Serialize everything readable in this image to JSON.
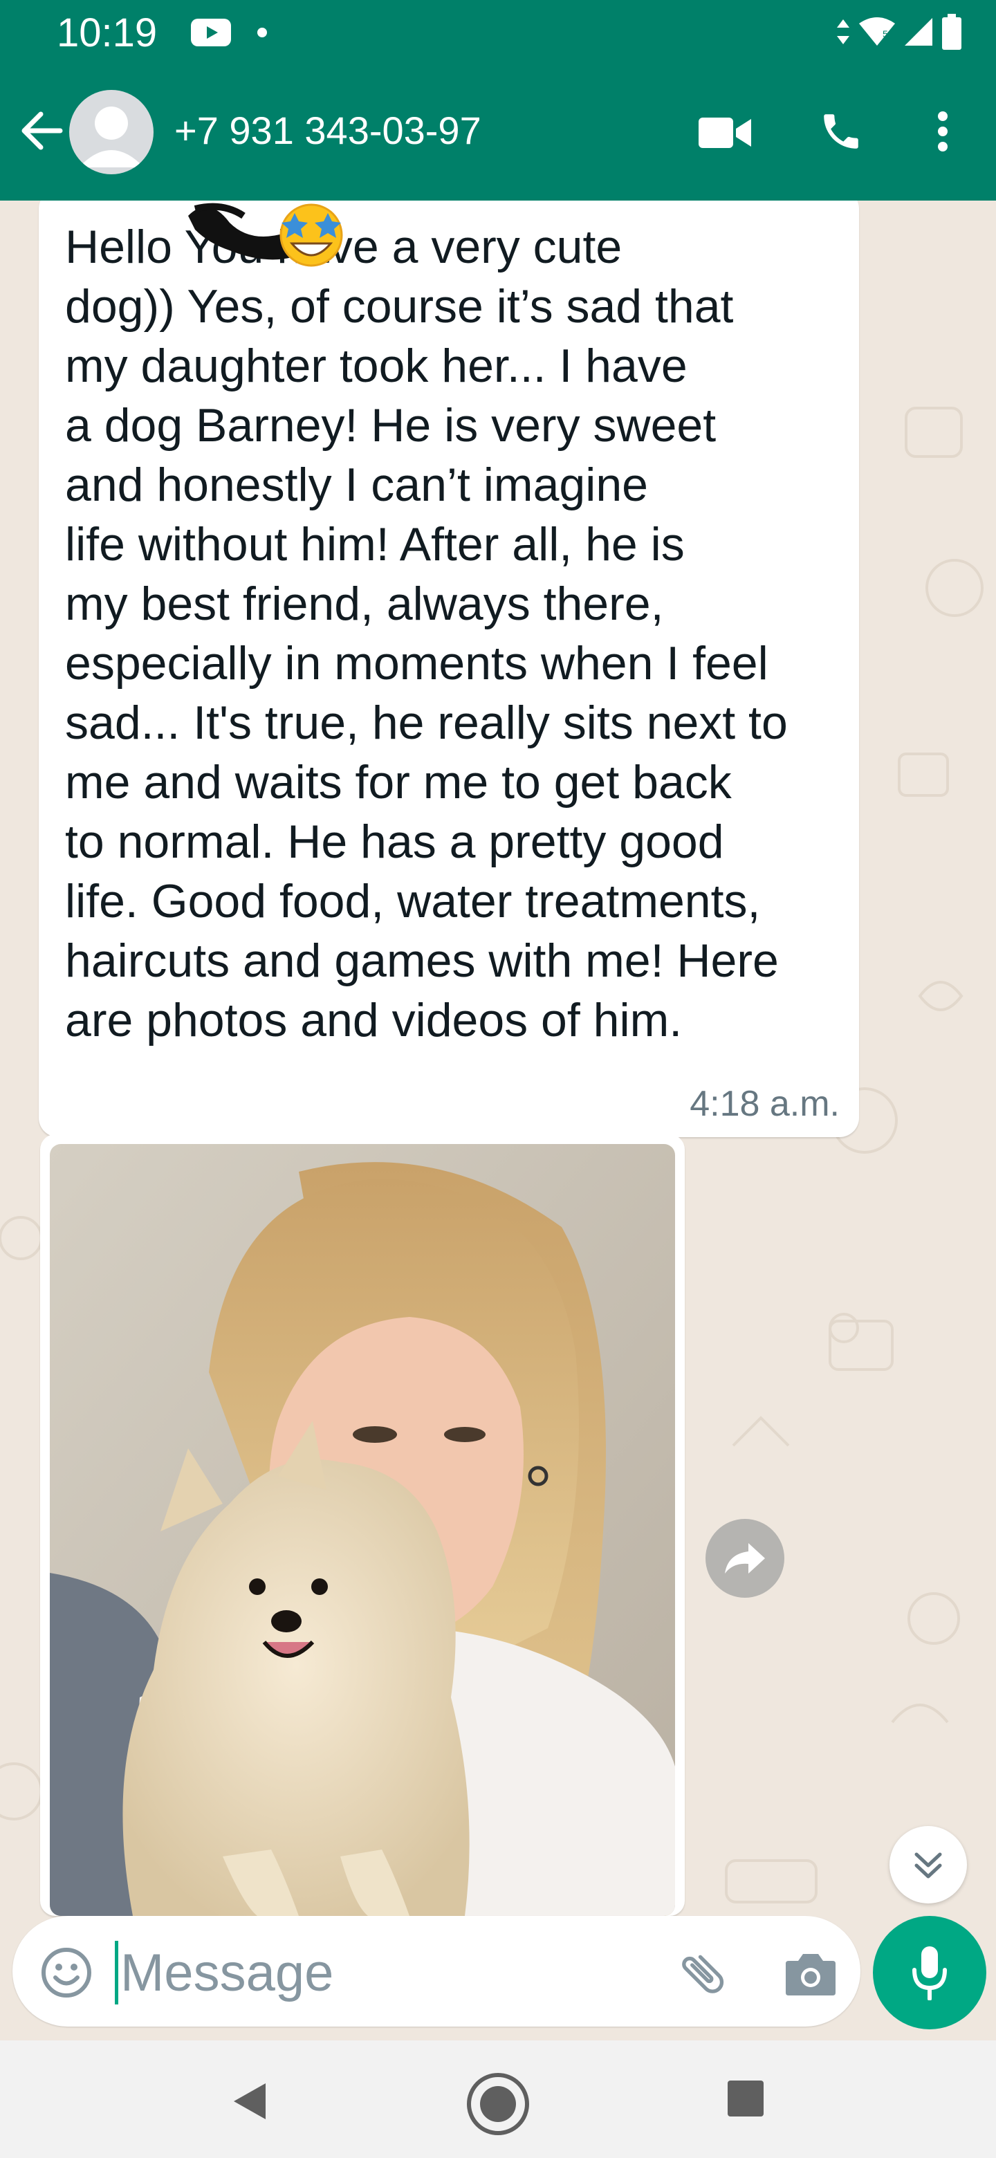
{
  "status_bar": {
    "time": "10:19",
    "icons": [
      "youtube-icon",
      "dot-icon",
      "data-arrows-icon",
      "wifi-icon",
      "signal-icon",
      "battery-icon"
    ]
  },
  "header": {
    "contact_name": "+7 931 343-03-97",
    "icons": [
      "back-arrow-icon",
      "avatar-icon",
      "video-call-icon",
      "voice-call-icon",
      "more-vert-icon"
    ]
  },
  "messages": [
    {
      "type": "text",
      "text": "Hello      You have a very cute\ndog)) Yes, of course it’s sad that\nmy daughter took her... I have\na dog Barney! He is very sweet\nand honestly I can’t imagine\nlife without him! After all, he is\nmy best friend, always there,\nespecially in moments when I feel\nsad... It's true, he really sits next to\nme and waits for me to get back\nto normal. He has a pretty good\nlife. Good food, water treatments,\nhaircuts and games with me! Here\nare photos and videos of him.",
      "time": "4:18 a.m."
    },
    {
      "type": "image",
      "description_icon": "photo-image"
    }
  ],
  "composer": {
    "placeholder": "Message",
    "value": "",
    "icons": [
      "emoji-icon",
      "attach-icon",
      "camera-icon",
      "mic-icon"
    ]
  },
  "navigation": {
    "icons": [
      "nav-back-icon",
      "nav-home-icon",
      "nav-recents-icon"
    ]
  },
  "colors": {
    "brand": "#008069",
    "accent": "#00a884",
    "chat_bg": "#efe7de",
    "bubble": "#ffffff",
    "meta_text": "#667781"
  }
}
